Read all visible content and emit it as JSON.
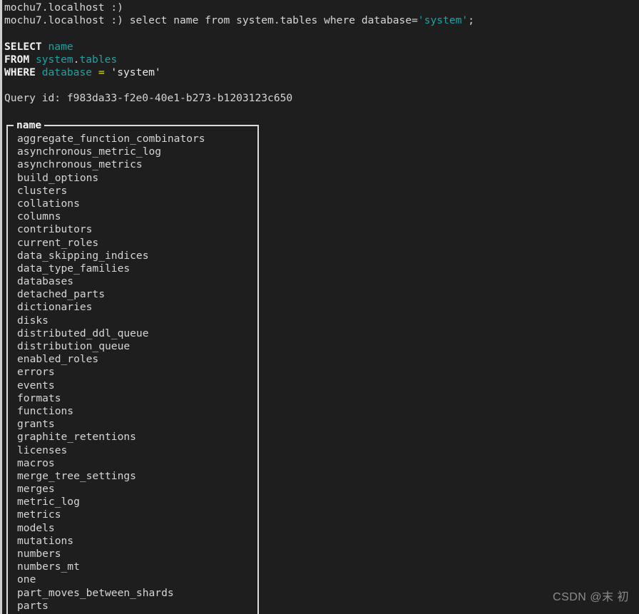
{
  "terminal": {
    "background_color": "#1e1e1e",
    "foreground_color": "#d6d6d6",
    "accent_identifier_color": "#19a3a3",
    "operator_color": "#e5e500",
    "keyword_color": "#f2f2f2",
    "prompt_host": "mochu7.localhost",
    "prompt_symbol": ":)",
    "prompt_line_1": "mochu7.localhost :)",
    "typed_command": {
      "prefix": "mochu7.localhost :) ",
      "text_plain": "select name from system.tables where database=",
      "string_literal": "'system'",
      "terminator": ";"
    },
    "echoed_query": {
      "line_1": {
        "keyword": "SELECT",
        "identifier": "name"
      },
      "line_2": {
        "keyword": "FROM",
        "identifier_db": "system",
        "dot": ".",
        "identifier_table": "tables"
      },
      "line_3": {
        "keyword": "WHERE",
        "identifier": "database",
        "operator": "=",
        "literal": "'system'"
      }
    },
    "query_id_label": "Query id:",
    "query_id_value": "f983da33-f2e0-40e1-b273-b1203123c650"
  },
  "result_table": {
    "column_header": "name",
    "rows": [
      "aggregate_function_combinators",
      "asynchronous_metric_log",
      "asynchronous_metrics",
      "build_options",
      "clusters",
      "collations",
      "columns",
      "contributors",
      "current_roles",
      "data_skipping_indices",
      "data_type_families",
      "databases",
      "detached_parts",
      "dictionaries",
      "disks",
      "distributed_ddl_queue",
      "distribution_queue",
      "enabled_roles",
      "errors",
      "events",
      "formats",
      "functions",
      "grants",
      "graphite_retentions",
      "licenses",
      "macros",
      "merge_tree_settings",
      "merges",
      "metric_log",
      "metrics",
      "models",
      "mutations",
      "numbers",
      "numbers_mt",
      "one",
      "part_moves_between_shards",
      "parts"
    ]
  },
  "watermark": {
    "text": "CSDN @末 初"
  }
}
